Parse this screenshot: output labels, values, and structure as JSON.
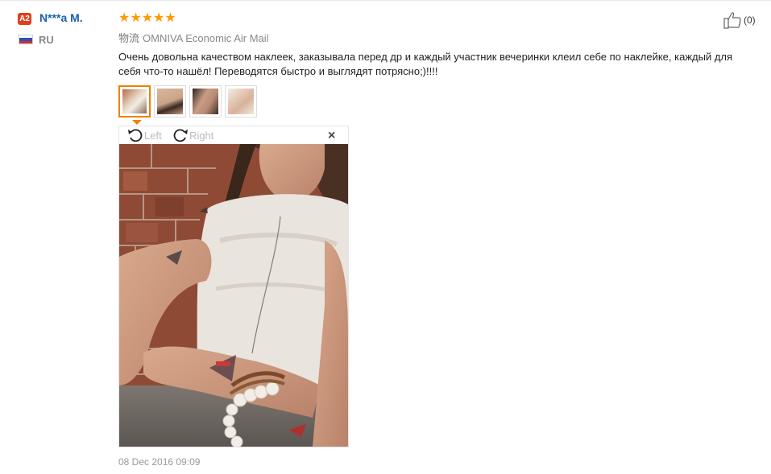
{
  "user": {
    "badge": "A2",
    "name": "N***a M.",
    "country": "RU",
    "flag_colors": [
      "#ffffff",
      "#2d52b5",
      "#d62b2b"
    ]
  },
  "review": {
    "rating": 5,
    "stars": [
      "★",
      "★",
      "★",
      "★",
      "★"
    ],
    "star_color": "#ff9a00",
    "shipping_label": "物流",
    "shipping_method": "OMNIVA Economic Air Mail",
    "text": "Очень довольна качеством наклеек, заказывала перед др и каждый участник вечеринки клеил себе по наклейке, каждый для себя что-то нашёл! Переводятся быстро и выглядят потрясно;)!!!!",
    "date": "08 Dec 2016 09:09"
  },
  "helpful": {
    "icon": "thumbs-up-icon",
    "count": "(0)"
  },
  "thumbnails": [
    {
      "icon": "photo-thumbnail",
      "active": true
    },
    {
      "icon": "photo-thumbnail",
      "active": false
    },
    {
      "icon": "photo-thumbnail",
      "active": false
    },
    {
      "icon": "photo-thumbnail",
      "active": false
    }
  ],
  "viewer": {
    "rotate_left_label": "Left",
    "rotate_right_label": "Right",
    "close_glyph": "×",
    "accent_color": "#f08000"
  }
}
